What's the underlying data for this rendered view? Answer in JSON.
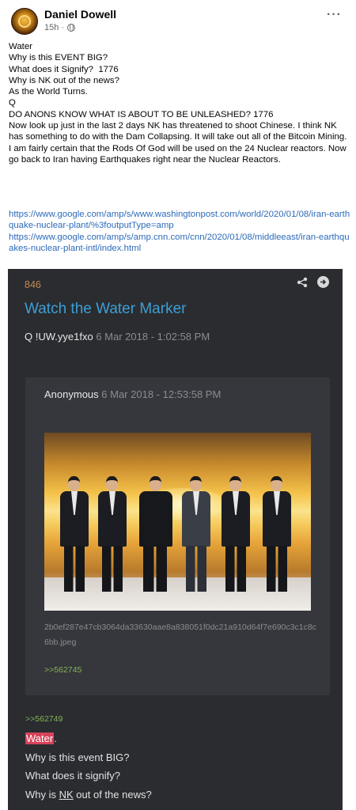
{
  "post": {
    "author": "Daniel Dowell",
    "time": "15h ·",
    "more_label": "···",
    "body_lines": [
      "Water",
      "Why is this EVENT BIG?",
      "What does it Signify?  1776",
      "Why is NK out of the news?",
      "As the World Turns.",
      "Q",
      "DO ANONS KNOW WHAT IS ABOUT TO BE UNLEASHED? 1776"
    ],
    "body_paragraph": "Now look up just in the last 2 days NK has threatened to shoot Chinese.  I think NK has something to do with the Dam Collapsing. It will take out all of the Bitcoin Mining. I am fairly certain that the Rods Of God will be used on the 24 Nuclear reactors. Now go back to Iran having Earthquakes right near the Nuclear Reactors.",
    "links": [
      "https://www.google.com/amp/s/www.washingtonpost.com/world/2020/01/08/iran-earthquake-nuclear-plant/%3foutputType=amp",
      "https://www.google.com/amp/s/amp.cnn.com/cnn/2020/01/08/middleeast/iran-earthquakes-nuclear-plant-intl/index.html"
    ]
  },
  "qpost": {
    "number": "846",
    "title": "Watch the Water Marker",
    "poster_name": "Q",
    "tripcode": "!UW.yye1fxo",
    "date": "6 Mar 2018 - 1:02:58 PM",
    "quoted": {
      "name": "Anonymous",
      "date": "6 Mar 2018 - 12:53:58 PM",
      "filename": "2b0ef287e47cb3064da33630aae8a838051f0dc21a910d64f7e690c3c1c8c6bb.jpeg",
      "link": ">>562745"
    },
    "reply": {
      "link": ">>562749",
      "highlight_word": "Water",
      "after_highlight": ".",
      "line2": "Why is this event BIG?",
      "line3": "What does it signify?",
      "line4_prefix": "Why is ",
      "line4_nk": "NK",
      "line4_suffix": " out of the news?"
    }
  },
  "colors": {
    "card_bg": "#2a2c30",
    "title_blue": "#3d9fd6",
    "post_number_orange": "#c7884f",
    "greentext": "#84b454",
    "highlight_red": "#d6435b",
    "fb_link_blue": "#2d6ab8"
  },
  "icons": [
    "globe-icon",
    "more-icon",
    "share-icon",
    "arrow-right-icon",
    "avatar"
  ]
}
